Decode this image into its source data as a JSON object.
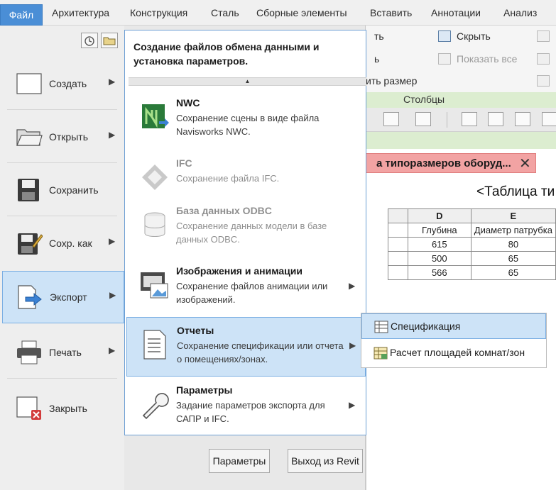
{
  "menubar": {
    "file_tab": "Файл",
    "tabs": [
      "Архитектура",
      "Конструкция",
      "Сталь",
      "Сборные элементы",
      "Вставить",
      "Аннотации",
      "Анализ"
    ]
  },
  "ribbon": {
    "hide": "Скрыть",
    "show_all": "Показать все",
    "partial_left_1": "ть",
    "partial_left_2": "ь",
    "partial_size": "ить размер",
    "panel_title": "Столбцы"
  },
  "doc_tab": {
    "title": "а типоразмеров оборуд...",
    "close": "✕"
  },
  "schedule": {
    "title": "<Таблица ти",
    "col_letters": [
      "",
      "D",
      "E"
    ],
    "headers": [
      "",
      "Глубина",
      "Диаметр патрубка"
    ],
    "rows": [
      [
        "",
        "615",
        "80"
      ],
      [
        "",
        "500",
        "65"
      ],
      [
        "",
        "566",
        "65"
      ]
    ]
  },
  "left_menu": {
    "items": [
      {
        "label": "Создать",
        "arrow": "▶"
      },
      {
        "label": "Открыть",
        "arrow": "▶"
      },
      {
        "label": "Сохранить",
        "arrow": ""
      },
      {
        "label": "Сохр. как",
        "arrow": "▶"
      },
      {
        "label": "Экспорт",
        "arrow": "▶"
      },
      {
        "label": "Печать",
        "arrow": "▶"
      },
      {
        "label": "Закрыть",
        "arrow": ""
      }
    ]
  },
  "submenu": {
    "header": "Создание файлов обмена данными и установка параметров.",
    "scroll_up": "▲",
    "items": [
      {
        "title": "NWC",
        "desc": "Сохранение сцены в виде файла Navisworks NWC.",
        "arrow": ""
      },
      {
        "title": "IFC",
        "desc": "Сохранение файла IFC.",
        "arrow": ""
      },
      {
        "title": "База данных ODBC",
        "desc": "Сохранение данных модели в базе данных ODBC.",
        "arrow": ""
      },
      {
        "title": "Изображения и анимации",
        "desc": "Сохранение файлов анимации или изображений.",
        "arrow": "▶"
      },
      {
        "title": "Отчеты",
        "desc": "Сохранение спецификации или отчета о помещениях/зонах.",
        "arrow": "▶"
      },
      {
        "title": "Параметры",
        "desc": "Задание параметров экспорта для САПР и IFC.",
        "arrow": "▶"
      }
    ]
  },
  "flyout": {
    "items": [
      "Спецификация",
      "Расчет площадей комнат/зон"
    ]
  },
  "buttons": {
    "options": "Параметры",
    "exit": "Выход из Revit"
  },
  "colors": {
    "accent": "#4a8ed6",
    "highlight": "#cde3f7",
    "highlight_border": "#7aaee3",
    "doc_tab": "#f2a3a3",
    "panel_green": "#dcedd0"
  }
}
